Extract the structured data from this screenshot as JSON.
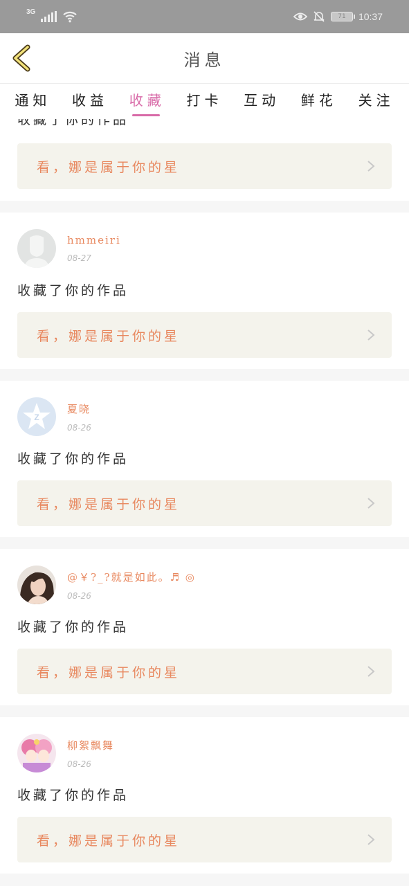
{
  "status_bar": {
    "network": "3G",
    "battery": "71",
    "time": "10:37",
    "icons": [
      "signal-icon",
      "wifi-icon",
      "eye-icon",
      "bell-off-icon",
      "battery-icon"
    ]
  },
  "header": {
    "title": "消息",
    "back_icon": "chevron-left-icon"
  },
  "tabs": [
    {
      "label": "通知"
    },
    {
      "label": "收益"
    },
    {
      "label": "收藏"
    },
    {
      "label": "打卡"
    },
    {
      "label": "互动"
    },
    {
      "label": "鲜花"
    },
    {
      "label": "关注"
    }
  ],
  "active_tab": "收藏",
  "colors": {
    "accent": "#d86aa8",
    "link": "#e8885f",
    "link_bg": "#f4f3ec",
    "status_bar": "#9a9a9a"
  },
  "partial_item": {
    "action": "收藏了你的作品",
    "link": "看，娜是属于你的星"
  },
  "items": [
    {
      "username": "hmmeiri",
      "date": "08-27",
      "action": "收藏了你的作品",
      "link": "看，娜是属于你的星",
      "avatar": "default-avatar"
    },
    {
      "username": "夏晓",
      "date": "08-26",
      "action": "收藏了你的作品",
      "link": "看，娜是属于你的星",
      "avatar": "qzone-avatar"
    },
    {
      "username": "@￥?_?就是如此。♬ ◎",
      "date": "08-26",
      "action": "收藏了你的作品",
      "link": "看，娜是属于你的星",
      "avatar": "photo-avatar"
    },
    {
      "username": "柳絮飘舞",
      "date": "08-26",
      "action": "收藏了你的作品",
      "link": "看，娜是属于你的星",
      "avatar": "anime-avatar"
    }
  ]
}
